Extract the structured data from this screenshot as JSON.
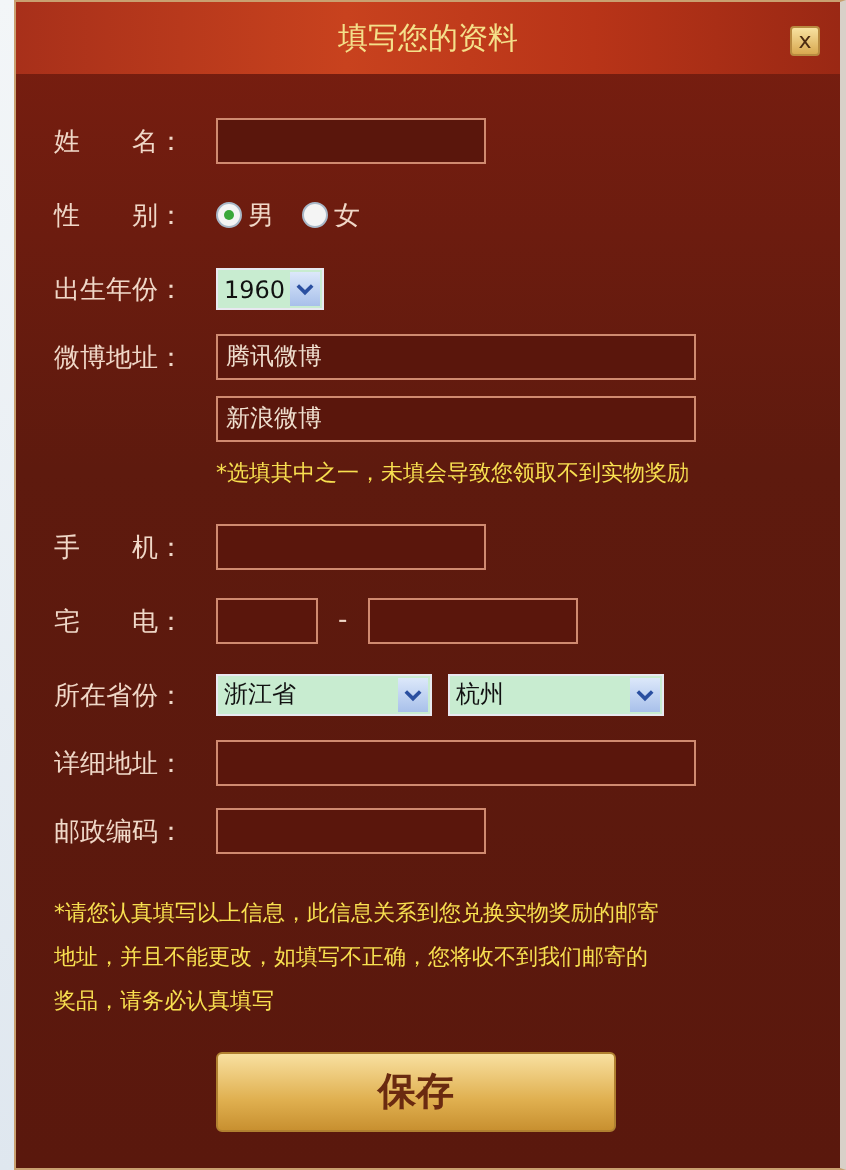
{
  "dialog": {
    "title": "填写您的资料",
    "close": "x"
  },
  "rows": [
    {
      "kind": "text",
      "label": "姓　　名：",
      "value": ""
    },
    {
      "kind": "radio",
      "label": "性　　别：",
      "options": [
        {
          "label": "男",
          "selected": true
        },
        {
          "label": "女",
          "selected": false
        }
      ]
    },
    {
      "kind": "select",
      "label": "出生年份：",
      "values": [
        "1960"
      ]
    },
    {
      "kind": "wide",
      "label": "微博地址：",
      "value": "腾讯微博"
    },
    {
      "kind": "wide",
      "value": "新浪微博"
    },
    {
      "kind": "note",
      "text": "*选填其中之一，未填会导致您领取不到实物奖励"
    },
    {
      "kind": "text",
      "label": "手　　机：",
      "value": ""
    },
    {
      "kind": "pair",
      "label": "宅　　电：",
      "separator": "-"
    },
    {
      "kind": "select",
      "label": "所在省份：",
      "values": [
        "浙江省",
        "杭州"
      ]
    },
    {
      "kind": "wide",
      "label": "详细地址：",
      "value": ""
    },
    {
      "kind": "text",
      "label": "邮政编码：",
      "value": ""
    }
  ],
  "notice": "*请您认真填写以上信息，此信息关系到您兑换实物奖励的邮寄地址，并且不能更改，如填写不正确，您将收不到我们邮寄的奖品，请务必认真填写",
  "save_button": "保存"
}
